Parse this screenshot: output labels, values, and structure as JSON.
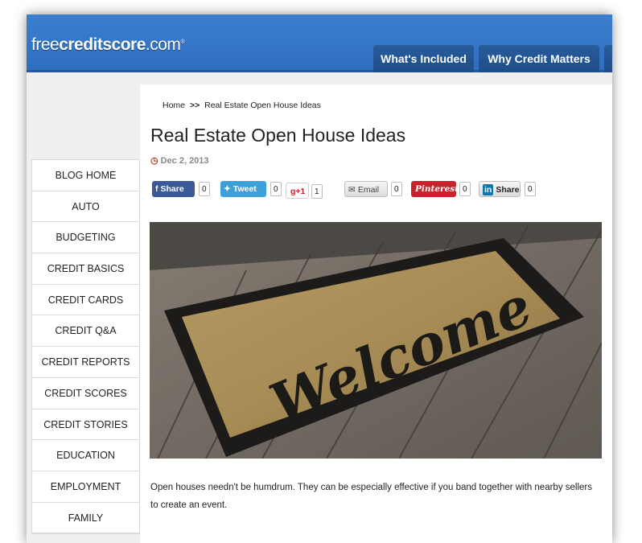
{
  "brand": {
    "pre": "free",
    "bold": "creditscore",
    "post": ".com",
    "reg": "®"
  },
  "nav": {
    "tabs": [
      {
        "label": "What's Included"
      },
      {
        "label": "Why Credit Matters"
      }
    ]
  },
  "sidebar": {
    "items": [
      {
        "label": "BLOG HOME"
      },
      {
        "label": "AUTO"
      },
      {
        "label": "BUDGETING"
      },
      {
        "label": "CREDIT BASICS"
      },
      {
        "label": "CREDIT CARDS"
      },
      {
        "label": "CREDIT Q&A"
      },
      {
        "label": "CREDIT REPORTS"
      },
      {
        "label": "CREDIT SCORES"
      },
      {
        "label": "CREDIT STORIES"
      },
      {
        "label": "EDUCATION"
      },
      {
        "label": "EMPLOYMENT"
      },
      {
        "label": "FAMILY"
      }
    ]
  },
  "breadcrumb": {
    "home": "Home",
    "separator": ">>",
    "current": "Real Estate Open House Ideas"
  },
  "article": {
    "title": "Real Estate Open House Ideas",
    "date": "Dec 2, 2013",
    "image_text": "Welcome",
    "body": "Open houses needn't be humdrum. They can be especially effective if you band together with nearby sellers to create an event."
  },
  "share": {
    "facebook": {
      "label": "Share",
      "count": "0"
    },
    "twitter": {
      "label": "Tweet",
      "count": "0"
    },
    "gplus": {
      "label": "+1",
      "count": "1"
    },
    "email": {
      "label": "Email",
      "count": "0"
    },
    "pinterest": {
      "label": "Pinterest",
      "count": "0"
    },
    "linkedin": {
      "label": "Share",
      "count": "0"
    }
  },
  "colors": {
    "header_blue": "#3b7ecf",
    "tab_blue": "#285c9c",
    "facebook": "#3b5998",
    "twitter": "#3ea0da",
    "pinterest": "#c8232c",
    "date_icon": "#c0392b"
  }
}
